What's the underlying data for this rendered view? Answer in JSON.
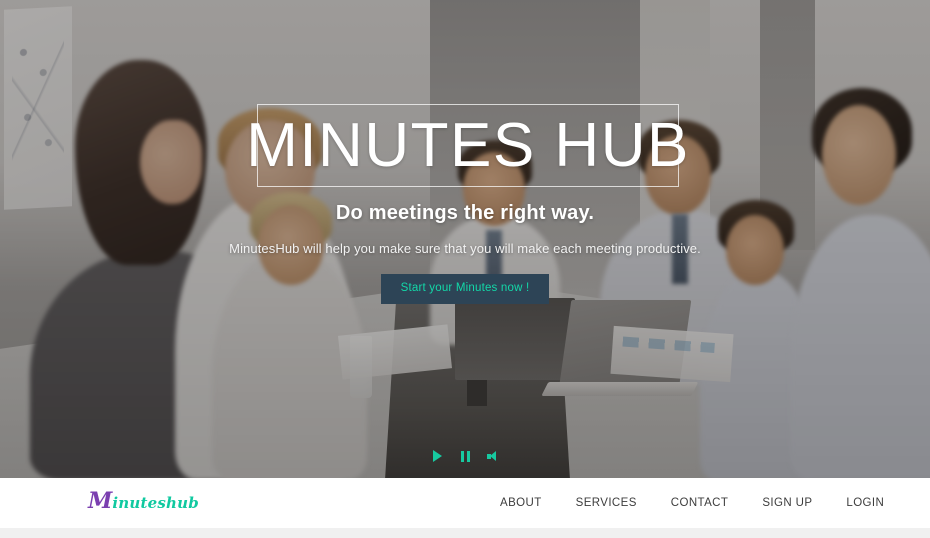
{
  "site": {
    "brand_initial": "M",
    "brand_rest": "inuteshub"
  },
  "hero": {
    "title": "MINUTES HUB",
    "subtitle": "Do meetings the right way.",
    "description": "MinutesHub will help you make sure that you will make each meeting productive.",
    "cta_label": "Start your Minutes now !",
    "accent_color": "#13d8a8",
    "cta_bg_color": "#2d4456"
  },
  "video_controls": {
    "play_label": "play-icon",
    "pause_label": "pause-icon",
    "volume_label": "volume-icon"
  },
  "nav": {
    "items": [
      {
        "label": "ABOUT"
      },
      {
        "label": "SERVICES"
      },
      {
        "label": "CONTACT"
      },
      {
        "label": "SIGN UP"
      },
      {
        "label": "LOGIN"
      }
    ]
  }
}
